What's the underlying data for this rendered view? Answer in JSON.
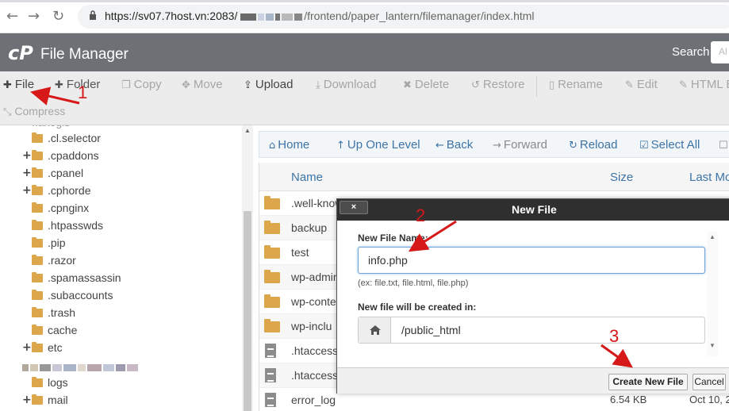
{
  "browser": {
    "url_prefix": "https://sv07.7host.vn:2083/",
    "url_suffix": "/frontend/paper_lantern/filemanager/index.html",
    "back_icon": "arrow-left-icon",
    "forward_icon": "arrow-right-icon",
    "reload_icon": "reload-icon",
    "lock_icon": "lock-icon"
  },
  "header": {
    "logo": "cP",
    "title": "File Manager",
    "search_label": "Search",
    "search_placeholder": "Al"
  },
  "toolbar": {
    "file": "File",
    "folder": "Folder",
    "copy": "Copy",
    "move": "Move",
    "upload": "Upload",
    "download": "Download",
    "delete": "Delete",
    "restore": "Restore",
    "rename": "Rename",
    "edit": "Edit",
    "html_editor": "HTML E",
    "compress": "Compress"
  },
  "tree": {
    "items": [
      {
        "label": ".cl.selector",
        "expandable": false
      },
      {
        "label": ".cpaddons",
        "expandable": true
      },
      {
        "label": ".cpanel",
        "expandable": true
      },
      {
        "label": ".cphorde",
        "expandable": true
      },
      {
        "label": ".cpnginx",
        "expandable": false
      },
      {
        "label": ".htpasswds",
        "expandable": false
      },
      {
        "label": ".pip",
        "expandable": false
      },
      {
        "label": ".razor",
        "expandable": false
      },
      {
        "label": ".spamassassin",
        "expandable": false
      },
      {
        "label": ".subaccounts",
        "expandable": false
      },
      {
        "label": ".trash",
        "expandable": false
      },
      {
        "label": "cache",
        "expandable": false
      },
      {
        "label": "etc",
        "expandable": true
      },
      {
        "label": "logs",
        "expandable": false
      },
      {
        "label": "mail",
        "expandable": true
      }
    ]
  },
  "nav": {
    "home": "Home",
    "up": "Up One Level",
    "back": "Back",
    "forward": "Forward",
    "reload": "Reload",
    "select_all": "Select All"
  },
  "table": {
    "col_name": "Name",
    "col_size": "Size",
    "col_modified": "Last Mo",
    "rows": [
      {
        "name": ".well-know",
        "type": "folder",
        "size": "",
        "date": ""
      },
      {
        "name": "backup",
        "type": "folder",
        "size": "",
        "date": ""
      },
      {
        "name": "test",
        "type": "folder",
        "size": "",
        "date": ""
      },
      {
        "name": "wp-admin",
        "type": "folder",
        "size": "",
        "date": ""
      },
      {
        "name": "wp-conte",
        "type": "folder",
        "size": "",
        "date": ""
      },
      {
        "name": "wp-inclu",
        "type": "folder",
        "size": "",
        "date": ""
      },
      {
        "name": ".htaccess",
        "type": "file",
        "size": "",
        "date": ""
      },
      {
        "name": ".htaccess",
        "type": "file",
        "size": "",
        "date": ""
      },
      {
        "name": "error_log",
        "type": "file",
        "size": "6.54 KB",
        "date": "Oct 10, 2"
      }
    ]
  },
  "modal": {
    "close": "×",
    "title": "New File",
    "name_label": "New File Name:",
    "name_value": "info.php",
    "hint": "(ex: file.txt, file.html, file.php)",
    "location_label": "New file will be created in:",
    "location_value": "/public_html",
    "create_button": "Create New File",
    "cancel_button": "Cancel"
  },
  "annotations": {
    "step1": "1",
    "step2": "2",
    "step3": "3",
    "color": "#d61818"
  }
}
